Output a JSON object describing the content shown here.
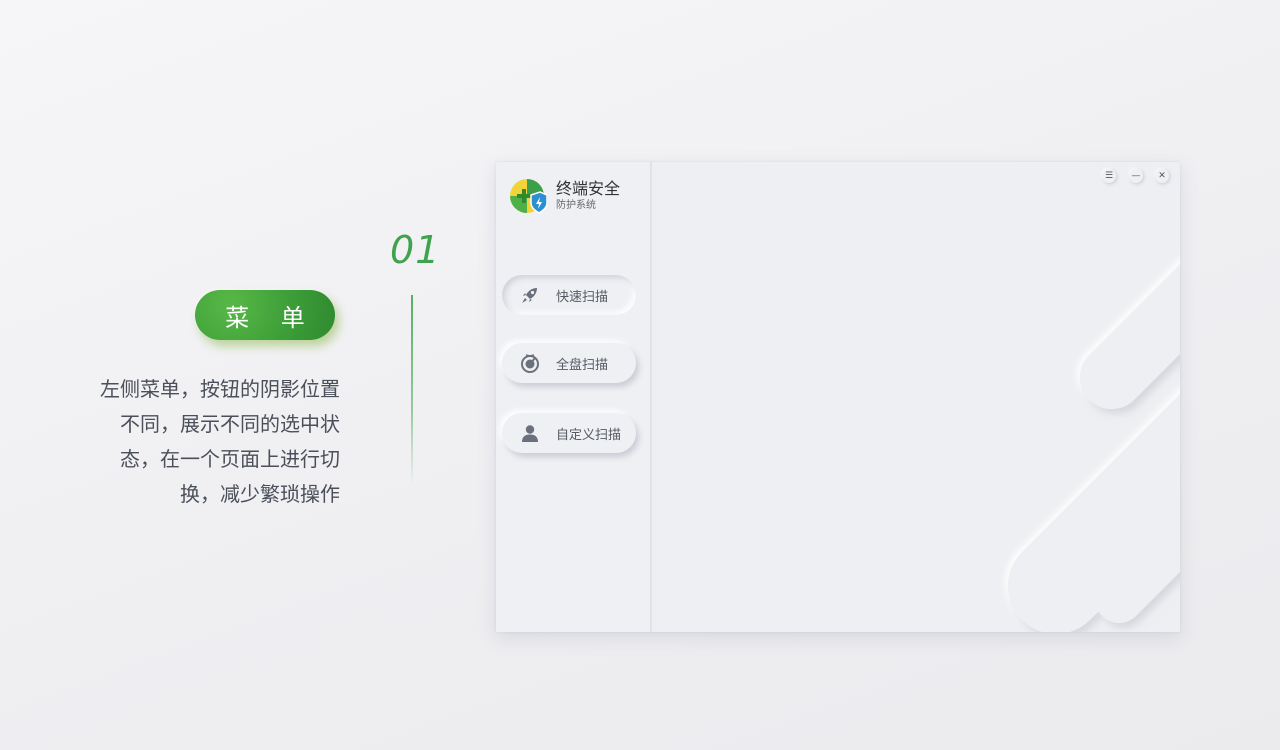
{
  "slide": {
    "step_number": "01",
    "menu_label": "菜 单",
    "description_lines": [
      "左侧菜单，按钮的阴影位置",
      "不同，展示不同的选中状",
      "态，在一个页面上进行切",
      "换，减少繁琐操作"
    ],
    "accent_color": "#3fa34d"
  },
  "app": {
    "brand": {
      "name": "终端安全",
      "subtitle": "防护系统"
    },
    "nav": [
      {
        "label": "快速扫描",
        "icon": "rocket-icon",
        "state": "active"
      },
      {
        "label": "全盘扫描",
        "icon": "radar-icon",
        "state": "default"
      },
      {
        "label": "自定义扫描",
        "icon": "user-icon",
        "state": "default"
      }
    ],
    "window_controls": {
      "settings": "☰",
      "minimize": "—",
      "close": "✕"
    }
  }
}
